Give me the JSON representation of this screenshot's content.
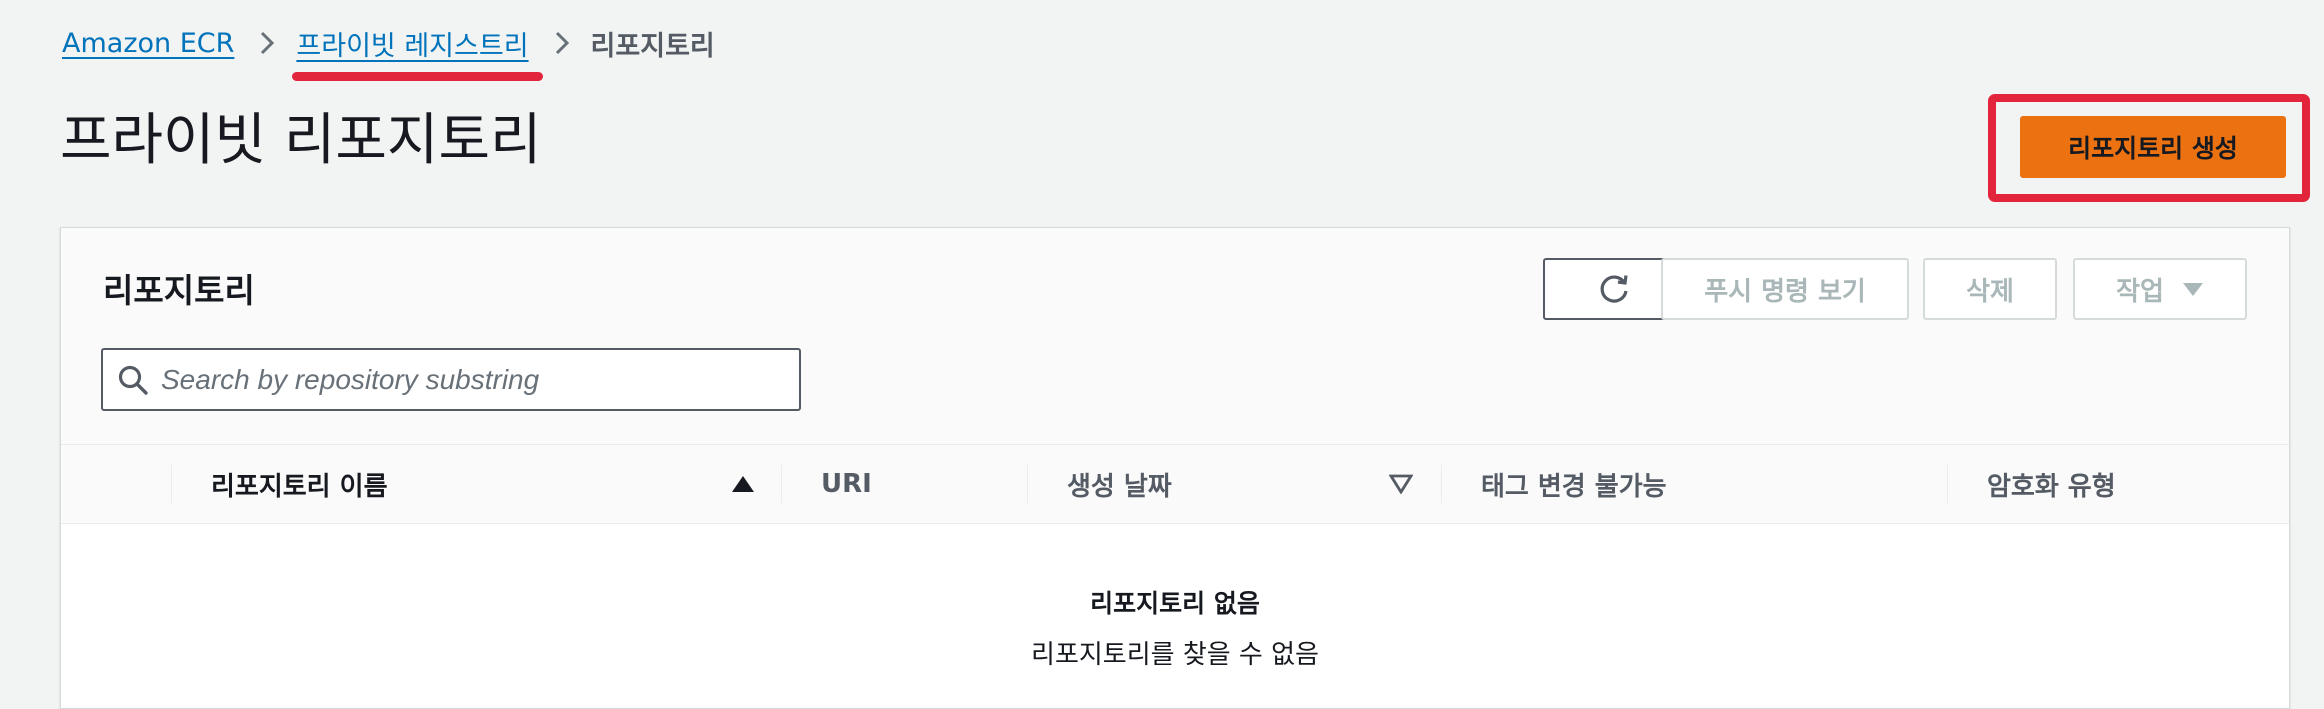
{
  "breadcrumb": {
    "root": "Amazon ECR",
    "parent": "프라이빗 레지스트리",
    "current": "리포지토리"
  },
  "page": {
    "title": "프라이빗 리포지토리",
    "create_button": "리포지토리 생성"
  },
  "panel": {
    "title": "리포지토리",
    "buttons": {
      "push_commands": "푸시 명령 보기",
      "delete": "삭제",
      "actions": "작업"
    },
    "search": {
      "placeholder": "Search by repository substring"
    },
    "columns": [
      "리포지토리 이름",
      "URI",
      "생성 날짜",
      "태그 변경 불가능",
      "암호화 유형"
    ],
    "empty": {
      "title": "리포지토리 없음",
      "message": "리포지토리를 찾을 수 없음"
    }
  },
  "colors": {
    "link": "#0073bb",
    "primary_button": "#ec7211",
    "highlight": "#e3253b",
    "background": "#f2f3f3"
  },
  "icons": [
    "chevron-right-icon",
    "refresh-icon",
    "caret-down-icon",
    "search-icon",
    "sort-ascending-icon",
    "sort-descending-icon"
  ]
}
